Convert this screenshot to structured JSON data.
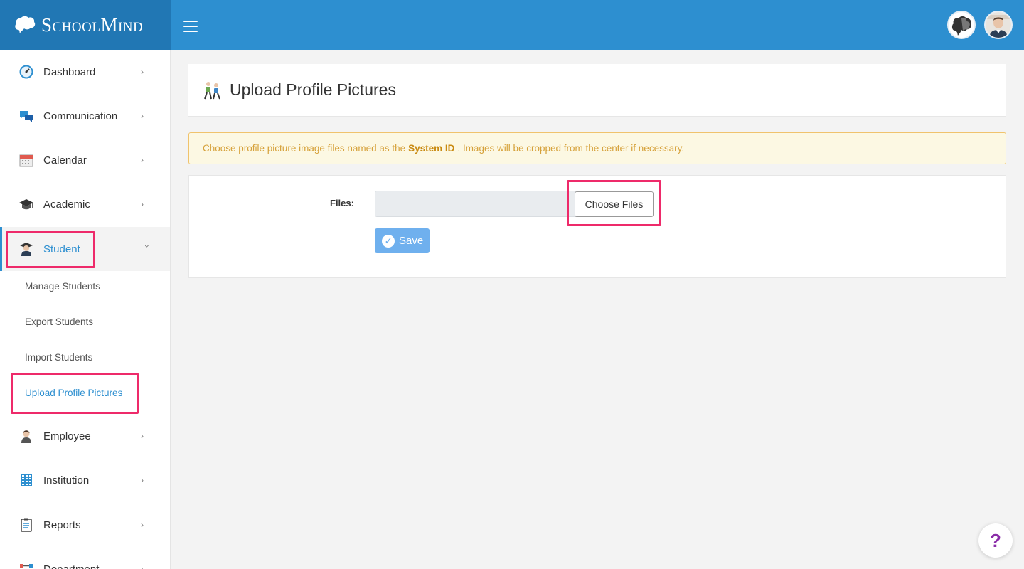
{
  "brand": {
    "name": "SchoolMind"
  },
  "colors": {
    "primary": "#2d8fd0",
    "brand_bg": "#2177b4",
    "highlight": "#ee2a6a",
    "warning_text": "#d6a13a"
  },
  "sidebar": {
    "items": [
      {
        "label": "Dashboard",
        "icon": "dashboard-gauge-icon"
      },
      {
        "label": "Communication",
        "icon": "chat-bubbles-icon"
      },
      {
        "label": "Calendar",
        "icon": "calendar-icon"
      },
      {
        "label": "Academic",
        "icon": "graduation-cap-icon"
      },
      {
        "label": "Student",
        "icon": "student-icon",
        "expanded": true
      },
      {
        "label": "Employee",
        "icon": "employee-icon"
      },
      {
        "label": "Institution",
        "icon": "building-icon"
      },
      {
        "label": "Reports",
        "icon": "clipboard-icon"
      },
      {
        "label": "Department",
        "icon": "department-icon"
      }
    ],
    "student_submenu": [
      "Manage Students",
      "Export Students",
      "Import Students",
      "Upload Profile Pictures"
    ]
  },
  "page": {
    "title": "Upload Profile Pictures",
    "alert": {
      "before": "Choose profile picture image files named as the",
      "bold": "System ID",
      "after": ". Images will be cropped from the center if necessary."
    },
    "form": {
      "files_label": "Files:",
      "choose_button": "Choose Files",
      "save_button": "Save"
    }
  },
  "help": {
    "label": "?"
  }
}
